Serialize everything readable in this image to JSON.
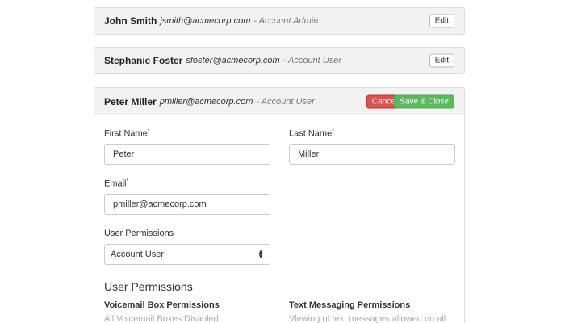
{
  "users": [
    {
      "name": "John Smith",
      "email": "jsmith@acmecorp.com",
      "role": "- Account Admin",
      "edit_label": "Edit"
    },
    {
      "name": "Stephanie Foster",
      "email": "sfoster@acmecorp.com",
      "role": "- Account User",
      "edit_label": "Edit"
    }
  ],
  "editing": {
    "name": "Peter Miller",
    "email": "pmiller@acmecorp.com",
    "role": "- Account User",
    "cancel_label": "Cancel",
    "save_label": "Save & Close"
  },
  "form": {
    "first_name_label": "First Name",
    "first_name_value": "Peter",
    "last_name_label": "Last Name",
    "last_name_value": "Miller",
    "email_label": "Email",
    "email_value": "pmiller@acmecorp.com",
    "required_mark": "*",
    "permissions_label": "User Permissions",
    "permissions_value": "Account User"
  },
  "permissions": {
    "title": "User Permissions",
    "voicemail_heading": "Voicemail Box Permissions",
    "voicemail_value": "All Voicemail Boxes Disabled",
    "text_heading": "Text Messaging Permissions",
    "text_value": "Viewing of text messages allowed on all"
  }
}
